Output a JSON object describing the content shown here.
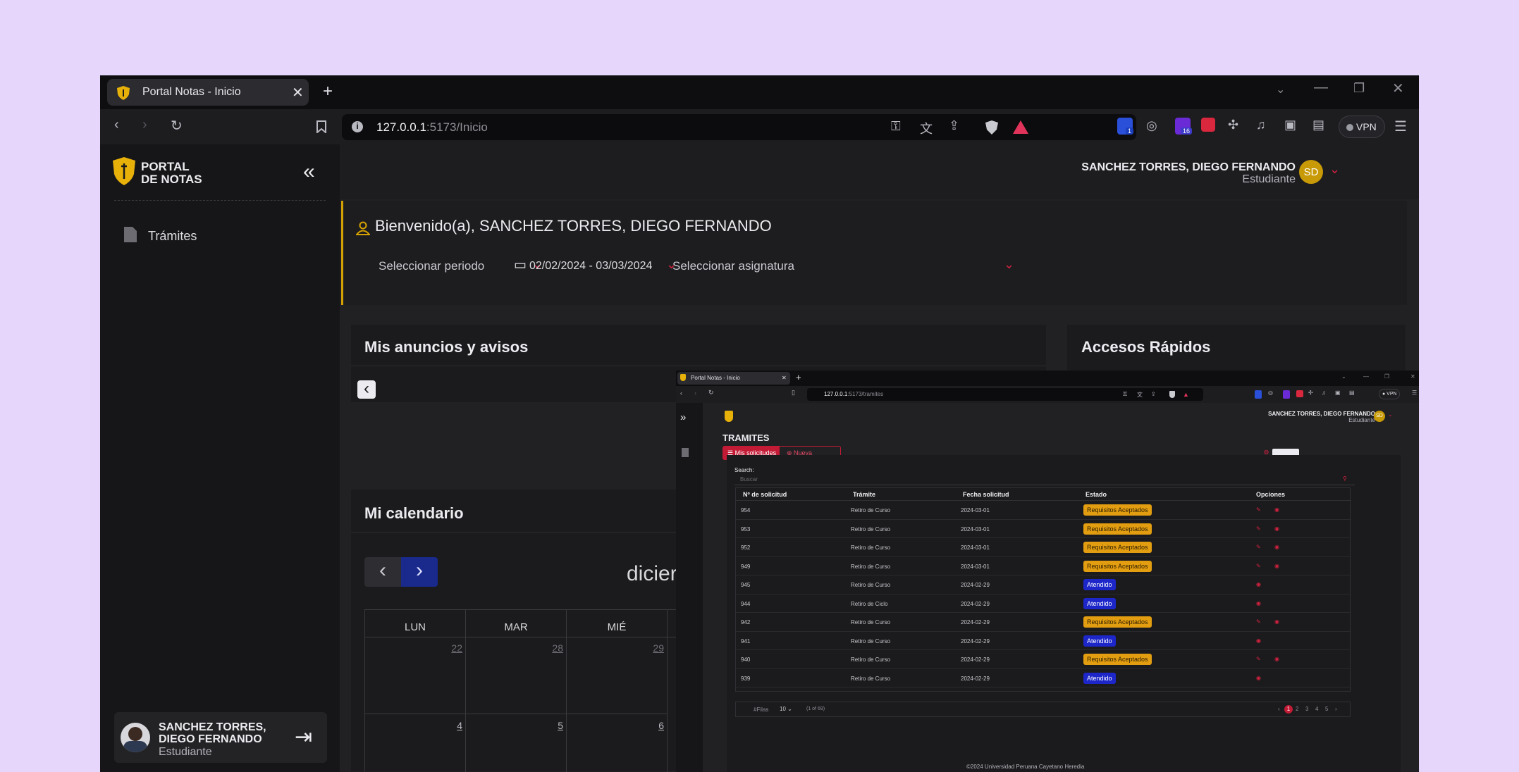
{
  "browser": {
    "tab_title": "Portal Notas - Inicio",
    "url_host": "127.0.0.1",
    "url_path": ":5173/Inicio",
    "vpn_label": "VPN",
    "badge_count_1": "1",
    "badge_count_2": "16"
  },
  "app": {
    "logo_line1": "PORTAL",
    "logo_line2": "DE NOTAS",
    "sidebar_items": [
      {
        "label": "Trámites",
        "icon": "document-icon"
      }
    ],
    "user": {
      "name": "SANCHEZ TORRES, DIEGO FERNANDO",
      "role": "Estudiante",
      "initials": "SD",
      "name_line1": "SANCHEZ TORRES,",
      "name_line2": "DIEGO FERNANDO"
    },
    "welcome": "Bienvenido(a), SANCHEZ TORRES, DIEGO FERNANDO",
    "filters": {
      "period_placeholder": "Seleccionar periodo",
      "date_range": "02/02/2024 - 03/03/2024",
      "subject_placeholder": "Seleccionar asignatura"
    },
    "announcements_title": "Mis anuncios y avisos",
    "quick_access_title": "Accesos Rápidos",
    "calendar": {
      "title": "Mi calendario",
      "month_partial": "dicier",
      "weekdays": [
        "LUN",
        "MAR",
        "MIÉ"
      ],
      "week1": [
        "22",
        "28",
        "29"
      ],
      "week2": [
        "4",
        "5",
        "6"
      ]
    }
  },
  "inner": {
    "tab_title": "Portal Notas - Inicio",
    "url_host": "127.0.0.1",
    "url_path": ":5173/tramites",
    "user_name": "SANCHEZ TORRES, DIEGO FERNANDO",
    "user_role": "Estudiante",
    "initials": "SD",
    "section_title": "TRAMITES",
    "tab_mine": "Mis solicitudes",
    "tab_new": "Nueva solicitudes",
    "search_label": "Search:",
    "search_placeholder": "Buscar",
    "columns": [
      "Nº de solicitud",
      "Trámite",
      "Fecha solicitud",
      "Estado",
      "Opciones"
    ],
    "rows": [
      {
        "id": "954",
        "tramite": "Retiro de Curso",
        "fecha": "2024-03-01",
        "estado": "Requisitos Aceptados",
        "kind": "y"
      },
      {
        "id": "953",
        "tramite": "Retiro de Curso",
        "fecha": "2024-03-01",
        "estado": "Requisitos Aceptados",
        "kind": "y"
      },
      {
        "id": "952",
        "tramite": "Retiro de Curso",
        "fecha": "2024-03-01",
        "estado": "Requisitos Aceptados",
        "kind": "y"
      },
      {
        "id": "949",
        "tramite": "Retiro de Curso",
        "fecha": "2024-03-01",
        "estado": "Requisitos Aceptados",
        "kind": "y"
      },
      {
        "id": "945",
        "tramite": "Retiro de Curso",
        "fecha": "2024-02-29",
        "estado": "Atendido",
        "kind": "b"
      },
      {
        "id": "944",
        "tramite": "Retiro de Ciclo",
        "fecha": "2024-02-29",
        "estado": "Atendido",
        "kind": "b"
      },
      {
        "id": "942",
        "tramite": "Retiro de Curso",
        "fecha": "2024-02-29",
        "estado": "Requisitos Aceptados",
        "kind": "y"
      },
      {
        "id": "941",
        "tramite": "Retiro de Curso",
        "fecha": "2024-02-29",
        "estado": "Atendido",
        "kind": "b"
      },
      {
        "id": "940",
        "tramite": "Retiro de Curso",
        "fecha": "2024-02-29",
        "estado": "Requisitos Aceptados",
        "kind": "y"
      },
      {
        "id": "939",
        "tramite": "Retiro de Curso",
        "fecha": "2024-02-29",
        "estado": "Atendido",
        "kind": "b"
      }
    ],
    "filas_label": "#Filas",
    "filas_value": "10",
    "pages_info": "(1 of 69)",
    "pages": [
      "1",
      "2",
      "3",
      "4",
      "5"
    ],
    "footer": "©2024 Universidad Peruana Cayetano Heredia"
  }
}
